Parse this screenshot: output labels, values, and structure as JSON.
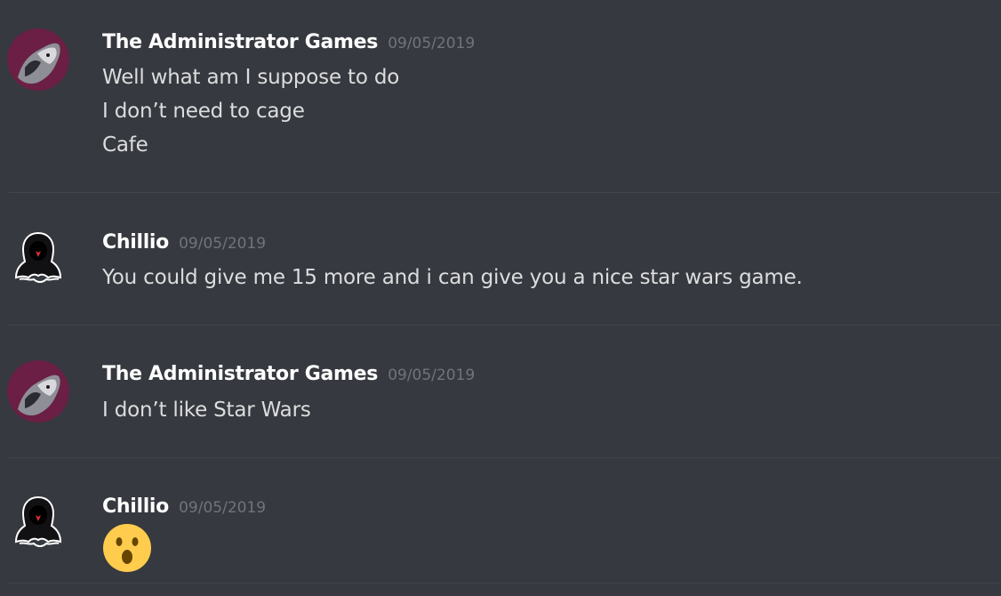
{
  "messages": [
    {
      "username": "The Administrator Games",
      "timestamp": "09/05/2019",
      "avatar_icon": "wolf-avatar",
      "lines": [
        "Well what am I suppose to do",
        "I don’t need to cage",
        "Cafe"
      ]
    },
    {
      "username": "Chillio",
      "timestamp": "09/05/2019",
      "avatar_icon": "hooded-figure-avatar",
      "lines": [
        "You could give me 15 more and i can give you a nice star wars game."
      ]
    },
    {
      "username": "The Administrator Games",
      "timestamp": "09/05/2019",
      "avatar_icon": "wolf-avatar",
      "lines": [
        "I don’t like Star Wars"
      ]
    },
    {
      "username": "Chillio",
      "timestamp": "09/05/2019",
      "avatar_icon": "hooded-figure-avatar",
      "emoji": "open-mouth-emoji"
    }
  ],
  "colors": {
    "background": "#36393f",
    "username": "#ffffff",
    "timestamp": "#71747a",
    "text": "#dcddde",
    "divider": "#42454a"
  }
}
